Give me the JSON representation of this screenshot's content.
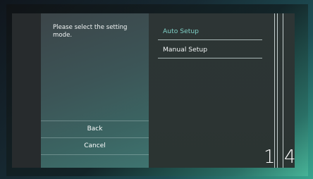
{
  "prompt": "Please select the setting mode.",
  "menu": {
    "items": [
      {
        "label": "Auto Setup",
        "state": "highlighted"
      },
      {
        "label": "Manual Setup",
        "state": "normal"
      }
    ]
  },
  "buttons": {
    "back": "Back",
    "cancel": "Cancel"
  },
  "steps": {
    "current": "1",
    "total": "4"
  },
  "colors": {
    "highlight_text": "#7fd0c6",
    "accent_bg": "#47b397"
  }
}
